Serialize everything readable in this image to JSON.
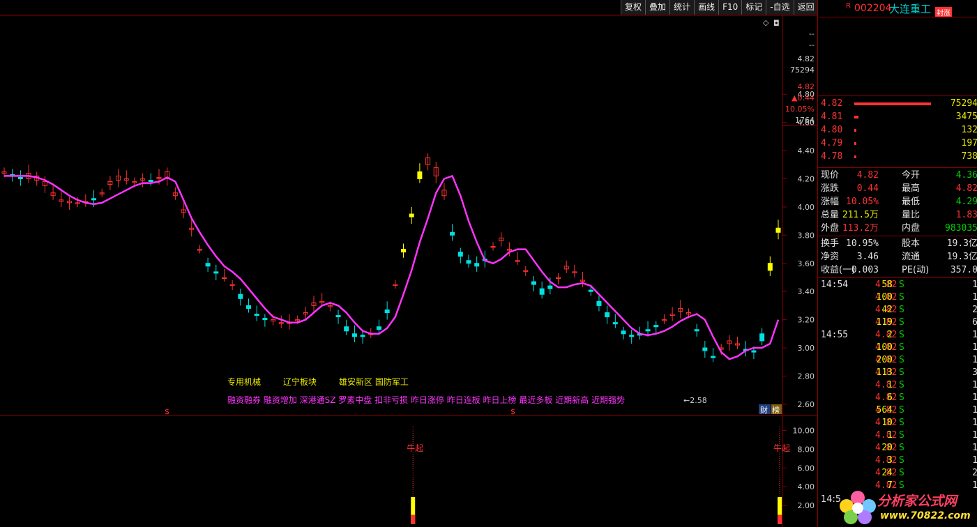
{
  "toolbar": {
    "items": [
      "复权",
      "叠加",
      "统计",
      "画线",
      "F10",
      "标记",
      "-自选",
      "返回"
    ]
  },
  "header": {
    "r_flag": "R",
    "code": "002204",
    "name": "大连重工",
    "badge": "封涨"
  },
  "price_axis": {
    "top_values": [
      "--",
      "--",
      "4.82",
      "75294",
      "4.82",
      "▲0.44",
      "10.05%",
      "1764"
    ],
    "ticks": [
      "4.80",
      "4.60",
      "4.40",
      "4.20",
      "4.00",
      "3.80",
      "3.60",
      "3.40",
      "3.20",
      "3.00",
      "2.80",
      "2.60"
    ]
  },
  "indicator_axis": {
    "ticks": [
      "10.00",
      "8.00",
      "6.00",
      "4.00",
      "2.00"
    ]
  },
  "chart_overlay": {
    "low_marker": "←2.58",
    "concept_tags_1": [
      "专用机械",
      "辽宁板块",
      "雄安新区 国防军工"
    ],
    "concept_tags_2": "融资融券 融资增加 深港通SZ 罗素中盘 扣非亏损 昨日涨停 昨日连板 昨日上榜 最近多板 近期新高 近期强势",
    "signal_label": "牛起",
    "dollar_mark": "$",
    "finance_btn": "财",
    "rank_btn": "榜",
    "diamond": "◇",
    "box_icon": "◘"
  },
  "order_book": [
    {
      "price": "4.82",
      "volume": "75294",
      "bar": 1.0
    },
    {
      "price": "4.81",
      "volume": "3475",
      "bar": 0.05
    },
    {
      "price": "4.80",
      "volume": "132",
      "bar": 0.02
    },
    {
      "price": "4.79",
      "volume": "197",
      "bar": 0.02
    },
    {
      "price": "4.78",
      "volume": "738",
      "bar": 0.02
    }
  ],
  "quote": [
    {
      "l1": "现价",
      "v1": "4.82",
      "c1": "red",
      "l2": "今开",
      "v2": "4.36",
      "c2": "green"
    },
    {
      "l1": "涨跌",
      "v1": "0.44",
      "c1": "red",
      "l2": "最高",
      "v2": "4.82",
      "c2": "red"
    },
    {
      "l1": "涨幅",
      "v1": "10.05%",
      "c1": "red",
      "l2": "最低",
      "v2": "4.29",
      "c2": "green"
    },
    {
      "l1": "总量",
      "v1": "211.5万",
      "c1": "yellow",
      "l2": "量比",
      "v2": "1.83",
      "c2": "red"
    },
    {
      "l1": "外盘",
      "v1": "113.2万",
      "c1": "red",
      "l2": "内盘",
      "v2": "983035",
      "c2": "green"
    },
    {
      "l1": "换手",
      "v1": "10.95%",
      "c1": "white",
      "l2": "股本",
      "v2": "19.3亿",
      "c2": "white"
    },
    {
      "l1": "净资",
      "v1": "3.46",
      "c1": "white",
      "l2": "流通",
      "v2": "19.3亿",
      "c2": "white"
    },
    {
      "l1": "收益(一)",
      "v1": "0.003",
      "c1": "white",
      "l2": "PE(动)",
      "v2": "357.0",
      "c2": "white"
    }
  ],
  "ticks_list": [
    {
      "time": "14:54",
      "price": "4.82",
      "vol": "58",
      "flag": "S",
      "n": "1"
    },
    {
      "time": "",
      "price": "4.82",
      "vol": "100",
      "flag": "S",
      "n": "1"
    },
    {
      "time": "",
      "price": "4.82",
      "vol": "42",
      "flag": "S",
      "n": "2"
    },
    {
      "time": "",
      "price": "4.82",
      "vol": "119",
      "flag": "S",
      "n": "6"
    },
    {
      "time": "14:55",
      "price": "4.82",
      "vol": "2",
      "flag": "S",
      "n": "1"
    },
    {
      "time": "",
      "price": "4.82",
      "vol": "100",
      "flag": "S",
      "n": "1"
    },
    {
      "time": "",
      "price": "4.82",
      "vol": "200",
      "flag": "S",
      "n": "1"
    },
    {
      "time": "",
      "price": "4.82",
      "vol": "113",
      "flag": "S",
      "n": "3"
    },
    {
      "time": "",
      "price": "4.82",
      "vol": "1",
      "flag": "S",
      "n": "1"
    },
    {
      "time": "",
      "price": "4.82",
      "vol": "6",
      "flag": "S",
      "n": "1"
    },
    {
      "time": "",
      "price": "4.82",
      "vol": "564",
      "flag": "S",
      "n": "1"
    },
    {
      "time": "",
      "price": "4.82",
      "vol": "10",
      "flag": "S",
      "n": "1"
    },
    {
      "time": "",
      "price": "4.82",
      "vol": "1",
      "flag": "S",
      "n": "1"
    },
    {
      "time": "",
      "price": "4.82",
      "vol": "20",
      "flag": "S",
      "n": "1"
    },
    {
      "time": "",
      "price": "4.82",
      "vol": "3",
      "flag": "S",
      "n": "1"
    },
    {
      "time": "",
      "price": "4.82",
      "vol": "24",
      "flag": "S",
      "n": "2"
    },
    {
      "time": "",
      "price": "4.82",
      "vol": "7",
      "flag": "S",
      "n": "1"
    }
  ],
  "footer_time": "14:5",
  "watermark": {
    "line1": "分析家公式网",
    "line2": "www.70822.com"
  },
  "chart_data": {
    "type": "line",
    "title": "",
    "xlabel": "",
    "ylabel": "",
    "ylim": [
      2.55,
      4.9
    ],
    "series": [
      {
        "name": "",
        "values": [
          4.25,
          4.22,
          4.2,
          4.24,
          4.22,
          4.18,
          4.1,
          4.05,
          4.04,
          4.03,
          4.04,
          4.05,
          4.1,
          4.18,
          4.22,
          4.2,
          4.18,
          4.2,
          4.18,
          4.21,
          4.25,
          4.1,
          3.98,
          3.85,
          3.7,
          3.58,
          3.53,
          3.5,
          3.45,
          3.35,
          3.28,
          3.23,
          3.2,
          3.2,
          3.18,
          3.18,
          3.2,
          3.25,
          3.32,
          3.33,
          3.3,
          3.22,
          3.12,
          3.08,
          3.08,
          3.1,
          3.13,
          3.25,
          3.45,
          3.7,
          3.95,
          4.25,
          4.35,
          4.28,
          4.12,
          3.8,
          3.65,
          3.6,
          3.58,
          3.62,
          3.72,
          3.78,
          3.7,
          3.62,
          3.55,
          3.45,
          3.38,
          3.42,
          3.5,
          3.58,
          3.54,
          3.48,
          3.4,
          3.3,
          3.22,
          3.17,
          3.1,
          3.08,
          3.09,
          3.12,
          3.15,
          3.2,
          3.24,
          3.28,
          3.25,
          3.12,
          2.98,
          2.93,
          3.0,
          3.05,
          3.03,
          2.98,
          2.97,
          3.05,
          3.6,
          3.85
        ]
      },
      {
        "name": "",
        "values": [
          4.24,
          4.23,
          4.21,
          4.2,
          4.19,
          4.15,
          4.08,
          4.04,
          4.03,
          4.03,
          4.04,
          4.06,
          4.1,
          4.16,
          4.19,
          4.19,
          4.18,
          4.19,
          4.19,
          4.2,
          4.2,
          4.08,
          3.96,
          3.84,
          3.7,
          3.6,
          3.54,
          3.5,
          3.45,
          3.38,
          3.3,
          3.24,
          3.21,
          3.19,
          3.18,
          3.18,
          3.2,
          3.24,
          3.3,
          3.32,
          3.3,
          3.23,
          3.15,
          3.1,
          3.09,
          3.1,
          3.15,
          3.27,
          3.45,
          3.68,
          3.93,
          4.2,
          4.3,
          4.22,
          4.08,
          3.82,
          3.68,
          3.62,
          3.6,
          3.63,
          3.72,
          3.76,
          3.7,
          3.62,
          3.55,
          3.47,
          3.42,
          3.44,
          3.5,
          3.56,
          3.54,
          3.48,
          3.41,
          3.33,
          3.25,
          3.18,
          3.12,
          3.09,
          3.1,
          3.13,
          3.16,
          3.2,
          3.23,
          3.26,
          3.24,
          3.13,
          3.0,
          2.94,
          2.99,
          3.03,
          3.02,
          2.99,
          2.98,
          3.1,
          3.55,
          3.82
        ]
      }
    ],
    "ma_line": [
      4.22,
      4.22,
      4.22,
      4.22,
      4.21,
      4.19,
      4.16,
      4.12,
      4.08,
      4.05,
      4.03,
      4.02,
      4.03,
      4.06,
      4.09,
      4.12,
      4.15,
      4.17,
      4.17,
      4.18,
      4.21,
      4.18,
      4.05,
      3.92,
      3.82,
      3.73,
      3.65,
      3.58,
      3.54,
      3.49,
      3.42,
      3.35,
      3.28,
      3.22,
      3.2,
      3.18,
      3.18,
      3.2,
      3.25,
      3.3,
      3.32,
      3.3,
      3.25,
      3.18,
      3.12,
      3.1,
      3.1,
      3.14,
      3.22,
      3.38,
      3.55,
      3.75,
      3.92,
      4.1,
      4.2,
      4.22,
      4.08,
      3.9,
      3.75,
      3.62,
      3.6,
      3.63,
      3.68,
      3.7,
      3.7,
      3.62,
      3.54,
      3.47,
      3.43,
      3.43,
      3.45,
      3.46,
      3.44,
      3.38,
      3.32,
      3.26,
      3.2,
      3.14,
      3.1,
      3.09,
      3.1,
      3.12,
      3.15,
      3.19,
      3.22,
      3.24,
      3.2,
      3.08,
      2.97,
      2.92,
      2.94,
      2.98,
      3.0,
      3.0,
      3.03,
      3.2
    ],
    "highlights": [
      49,
      50,
      51,
      94,
      95
    ],
    "indicator_bars": [
      {
        "index": 50,
        "value": 2.9
      },
      {
        "index": 95,
        "value": 2.9
      }
    ],
    "indicator_ylim": [
      0,
      11
    ]
  },
  "colors": {
    "up": "#ff3232",
    "down": "#00e0e0",
    "ma": "#ff33ff",
    "highlight": "#ffff00",
    "border": "#8b0000",
    "tag_yellow": "#e8e800",
    "tag_magenta": "#ff33ff"
  }
}
